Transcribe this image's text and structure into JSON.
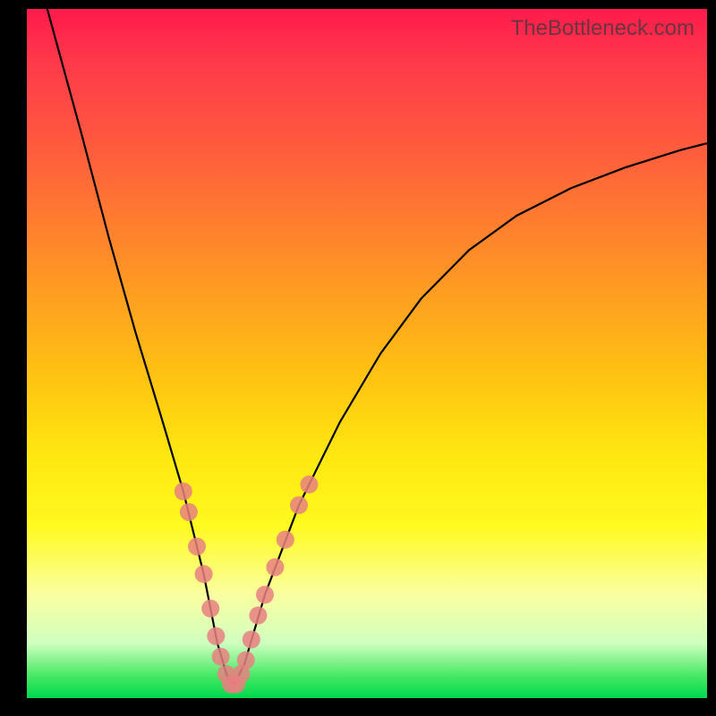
{
  "watermark": "TheBottleneck.com",
  "colors": {
    "background": "#000000",
    "gradient_top": "#ff1a4d",
    "gradient_bottom": "#00d850",
    "curve": "#000000",
    "marker": "#e88080"
  },
  "chart_data": {
    "type": "line",
    "title": "",
    "xlabel": "",
    "ylabel": "",
    "xlim": [
      0,
      100
    ],
    "ylim": [
      0,
      100
    ],
    "series": [
      {
        "name": "curve",
        "x": [
          3,
          8,
          12,
          16,
          20,
          23,
          26,
          28,
          29.5,
          30.5,
          32,
          35,
          40,
          46,
          52,
          58,
          65,
          72,
          80,
          88,
          96,
          100
        ],
        "y": [
          100,
          82,
          67,
          53,
          40,
          30,
          18,
          8,
          3,
          2,
          5,
          15,
          28,
          40,
          50,
          58,
          65,
          70,
          74,
          77,
          79.5,
          80.5
        ]
      }
    ],
    "markers": {
      "name": "highlight-points",
      "points": [
        {
          "x": 23,
          "y": 30
        },
        {
          "x": 23.8,
          "y": 27
        },
        {
          "x": 25,
          "y": 22
        },
        {
          "x": 26,
          "y": 18
        },
        {
          "x": 27,
          "y": 13
        },
        {
          "x": 27.8,
          "y": 9
        },
        {
          "x": 28.5,
          "y": 6
        },
        {
          "x": 29.3,
          "y": 3.5
        },
        {
          "x": 30,
          "y": 2
        },
        {
          "x": 30.8,
          "y": 2
        },
        {
          "x": 31.5,
          "y": 3.5
        },
        {
          "x": 32.2,
          "y": 5.5
        },
        {
          "x": 33,
          "y": 8.5
        },
        {
          "x": 34,
          "y": 12
        },
        {
          "x": 35,
          "y": 15
        },
        {
          "x": 36.5,
          "y": 19
        },
        {
          "x": 38,
          "y": 23
        },
        {
          "x": 40,
          "y": 28
        },
        {
          "x": 41.5,
          "y": 31
        }
      ]
    }
  }
}
